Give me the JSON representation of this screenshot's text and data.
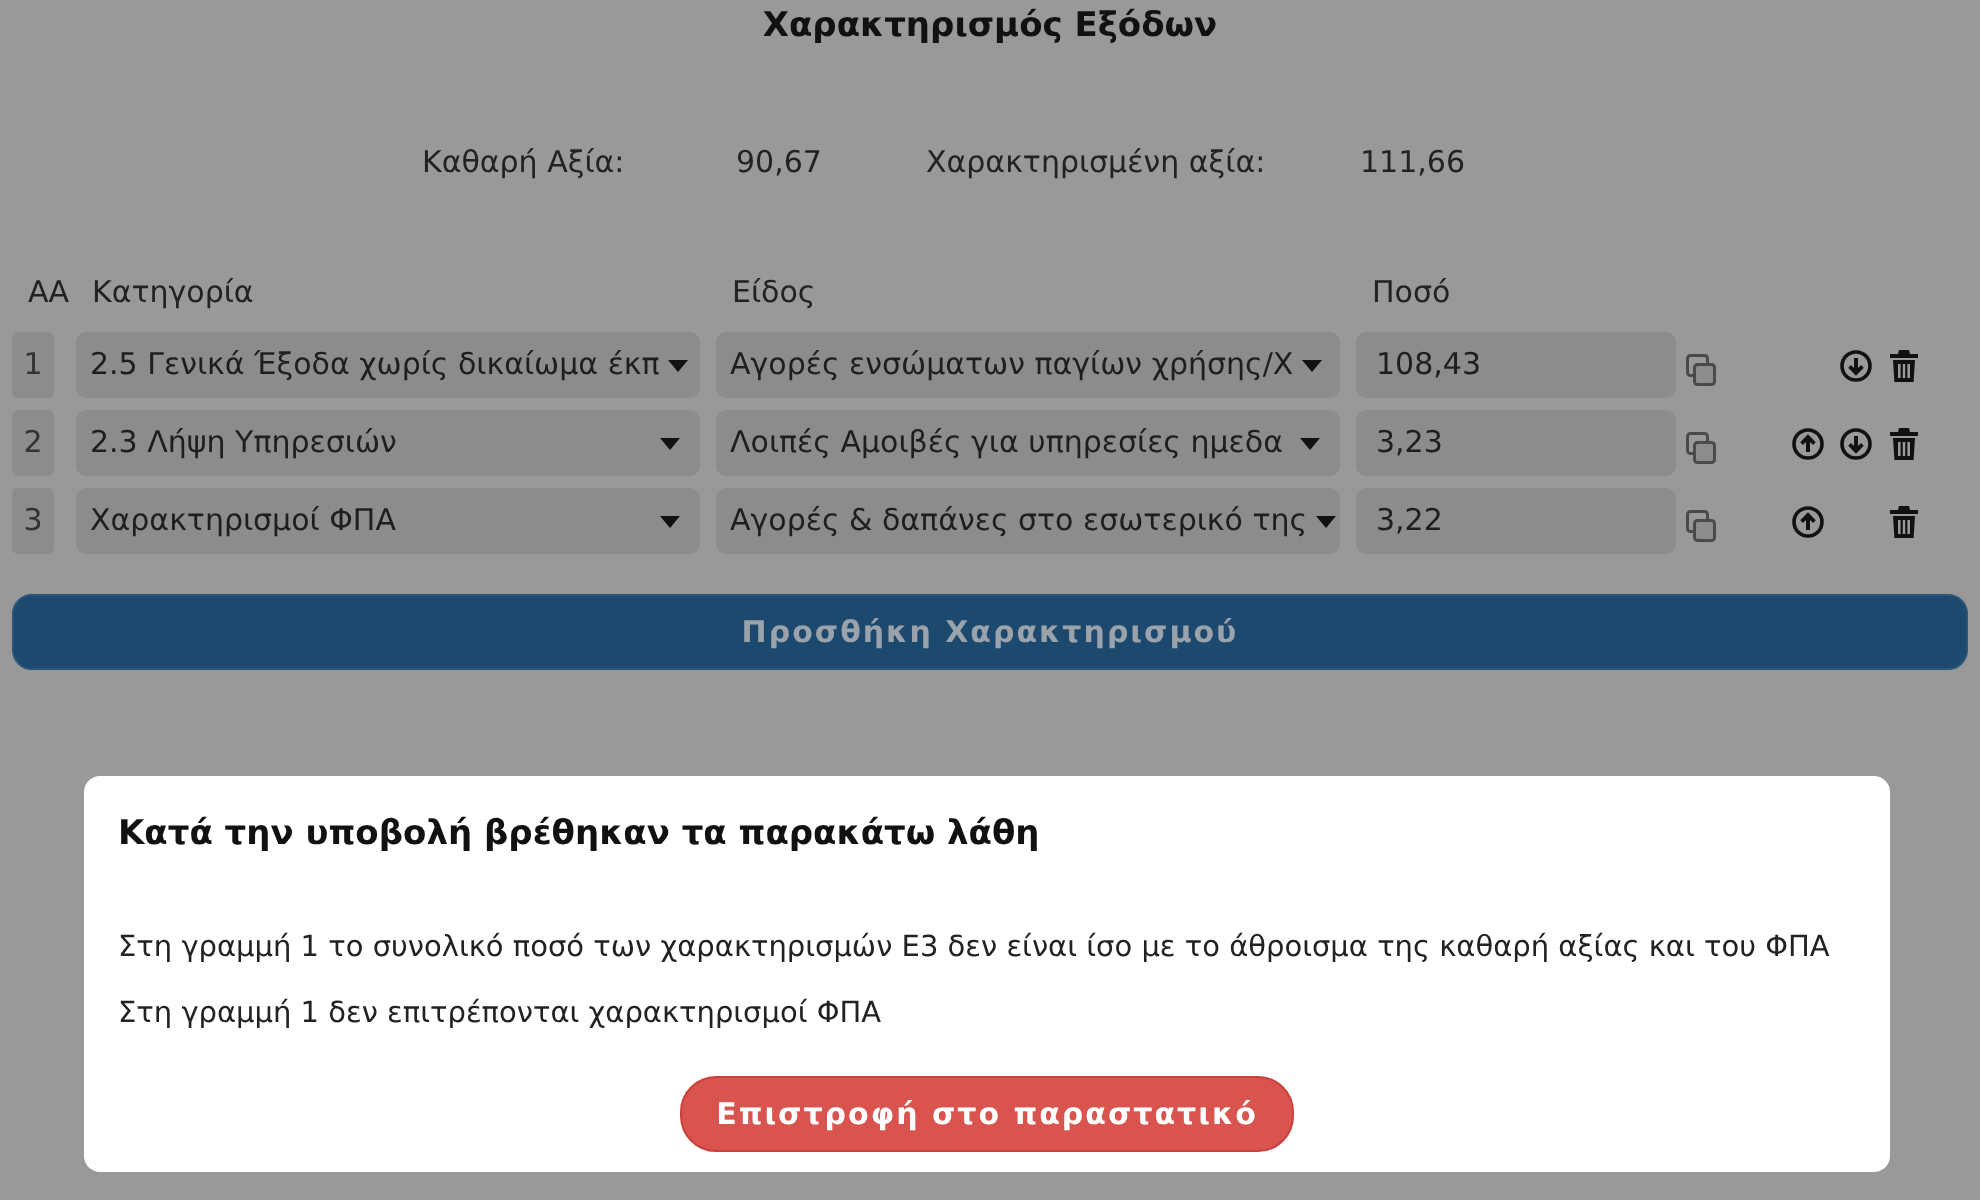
{
  "page": {
    "title": "Χαρακτηρισμός Εξόδων"
  },
  "summary": [
    {
      "label": "Καθαρή Αξία:",
      "value": "90,67"
    },
    {
      "label": "Χαρακτηρισμένη αξία:",
      "value": "111,66"
    }
  ],
  "table": {
    "columns": [
      "ΑΑ",
      "Κατηγορία",
      "Είδος",
      "Ποσό"
    ],
    "rows": [
      {
        "aa": "1",
        "category": "2.5 Γενικά Έξοδα χωρίς δικαίωμα έκπ",
        "type": "Αγορές ενσώματων παγίων χρήσης/Χ",
        "amount": "108,43",
        "can_move_up": false,
        "can_move_down": true
      },
      {
        "aa": "2",
        "category": "2.3 Λήψη Υπηρεσιών",
        "type": "Λοιπές Αμοιβές για υπηρεσίες ημεδα",
        "amount": "3,23",
        "can_move_up": true,
        "can_move_down": true
      },
      {
        "aa": "3",
        "category": "Χαρακτηρισμοί ΦΠΑ",
        "type": "Αγορές & δαπάνες στο εσωτερικό της",
        "amount": "3,22",
        "can_move_up": true,
        "can_move_down": false
      }
    ]
  },
  "add_button": {
    "label": "Προσθήκη Χαρακτηρισμού"
  },
  "error_dialog": {
    "title": "Κατά την υποβολή βρέθηκαν τα παρακάτω λάθη",
    "messages": [
      "Στη γραμμή 1 το συνολικό ποσό των χαρακτηρισμών Ε3 δεν είναι ίσο με το άθροισμα της καθαρή αξίας και του ΦΠΑ",
      "Στη γραμμή 1 δεν επιτρέπονται χαρακτηρισμοί ΦΠΑ"
    ],
    "button": "Επιστροφή στο παραστατικό"
  }
}
